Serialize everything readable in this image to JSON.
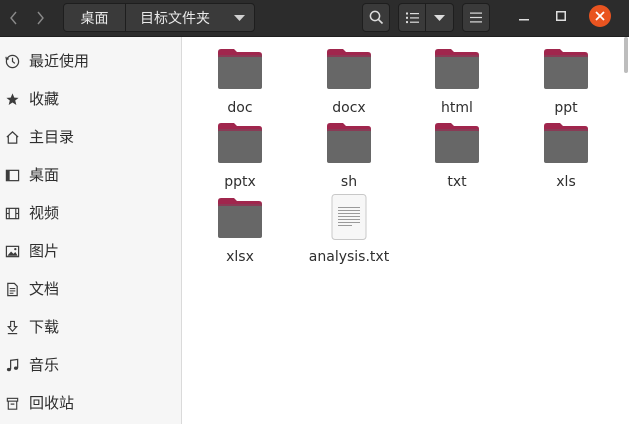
{
  "header": {
    "back_icon": "chevron-left-icon",
    "forward_icon": "chevron-right-icon",
    "breadcrumbs": [
      "桌面",
      "目标文件夹"
    ],
    "search_icon": "search-icon",
    "view_icon": "list-view-icon",
    "view_menu_icon": "chevron-down-icon",
    "menu_icon": "hamburger-menu-icon",
    "minimize_icon": "minimize-icon",
    "maximize_icon": "maximize-icon",
    "close_icon": "close-icon",
    "close_color": "#e95420"
  },
  "sidebar": {
    "items": [
      {
        "label": "最近使用",
        "icon": "clock-icon"
      },
      {
        "label": "收藏",
        "icon": "star-icon"
      },
      {
        "label": "主目录",
        "icon": "home-icon"
      },
      {
        "label": "桌面",
        "icon": "desktop-icon"
      },
      {
        "label": "视频",
        "icon": "film-icon"
      },
      {
        "label": "图片",
        "icon": "picture-icon"
      },
      {
        "label": "文档",
        "icon": "document-icon"
      },
      {
        "label": "下载",
        "icon": "download-icon"
      },
      {
        "label": "音乐",
        "icon": "music-icon"
      },
      {
        "label": "回收站",
        "icon": "trash-icon"
      }
    ]
  },
  "files": [
    {
      "name": "doc",
      "type": "folder"
    },
    {
      "name": "docx",
      "type": "folder"
    },
    {
      "name": "html",
      "type": "folder"
    },
    {
      "name": "ppt",
      "type": "folder"
    },
    {
      "name": "pptx",
      "type": "folder"
    },
    {
      "name": "sh",
      "type": "folder"
    },
    {
      "name": "txt",
      "type": "folder"
    },
    {
      "name": "xls",
      "type": "folder"
    },
    {
      "name": "xlsx",
      "type": "folder"
    },
    {
      "name": "analysis.txt",
      "type": "text-file"
    }
  ],
  "colors": {
    "header_bg": "#2c2c2c",
    "folder_tab": "#a0264d",
    "folder_body": "#676767",
    "accent": "#e95420"
  }
}
